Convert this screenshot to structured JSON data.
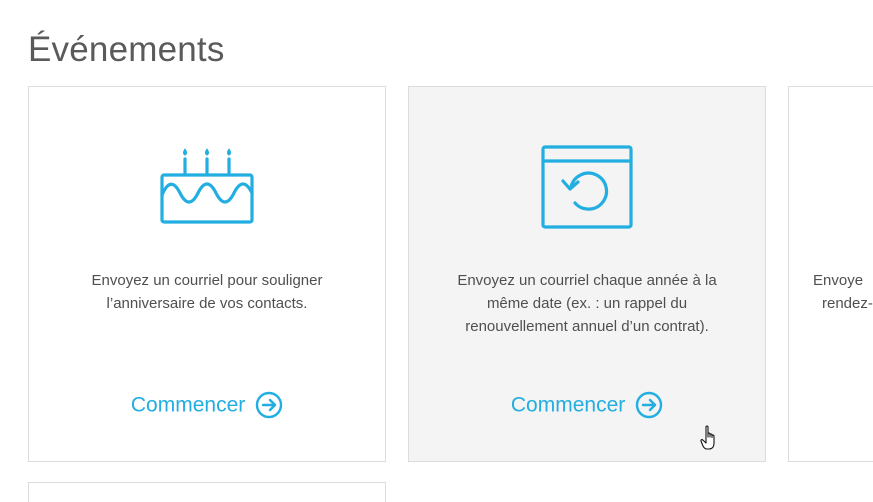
{
  "page": {
    "title": "Événements"
  },
  "colors": {
    "accent": "#22aee0",
    "text": "#4f4f4f",
    "title": "#5a5a5a",
    "card_border": "#dcdcdc",
    "card_hover_bg": "#f4f4f4"
  },
  "cards": [
    {
      "icon": "birthday-cake-icon",
      "description": "Envoyez un courriel pour souligner l’anniversaire de vos contacts.",
      "cta_label": "Commencer",
      "cta_icon": "arrow-right-circle-icon"
    },
    {
      "icon": "calendar-recurring-icon",
      "description": "Envoyez un courriel chaque année à la même date (ex. : un rappel du renouvellement annuel d’un contrat).",
      "cta_label": "Commencer",
      "cta_icon": "arrow-right-circle-icon"
    },
    {
      "description_line_1": "Envoye",
      "description_line_2": "rendez-"
    }
  ]
}
